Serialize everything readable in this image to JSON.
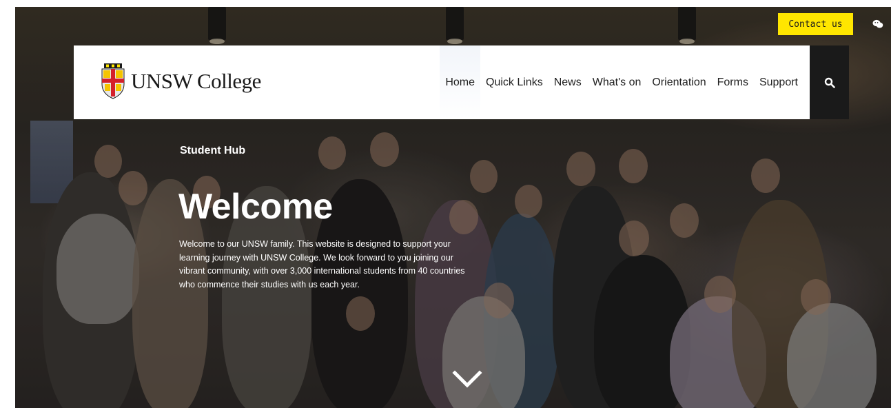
{
  "topbar": {
    "contact_label": "Contact us"
  },
  "header": {
    "logo_text": "UNSW College",
    "nav": [
      {
        "label": "Home"
      },
      {
        "label": "Quick Links"
      },
      {
        "label": "News"
      },
      {
        "label": "What's on"
      },
      {
        "label": "Orientation"
      },
      {
        "label": "Forms"
      },
      {
        "label": "Support"
      }
    ]
  },
  "hero": {
    "eyebrow": "Student Hub",
    "title": "Welcome",
    "intro": "Welcome to our UNSW family. This website is designed to support your learning journey with UNSW College. We look forward to you joining our vibrant community, with over 3,000 international students from 40 countries who commence their studies with us each year."
  },
  "icons": {
    "search": "search-icon",
    "wechat": "wechat-icon",
    "scroll": "chevron-down-icon",
    "crest": "unsw-crest-logo"
  },
  "colors": {
    "accent": "#ffe600",
    "nav_bg": "#ffffff",
    "search_bg": "#1a1a1a"
  }
}
